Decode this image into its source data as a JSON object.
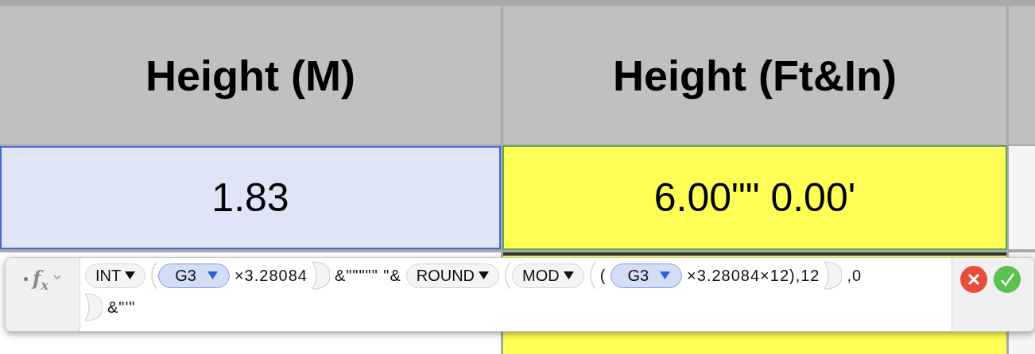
{
  "table": {
    "columns": [
      {
        "label": "Height (M)"
      },
      {
        "label": "Height (Ft&In)"
      }
    ],
    "rows": [
      {
        "cells": [
          {
            "value": "1.83",
            "selected": true,
            "editing": false,
            "color": "#dfe5f7"
          },
          {
            "value": "6.00\"\" 0.00'",
            "selected": false,
            "editing": true,
            "color": "#ffff55"
          }
        ]
      }
    ]
  },
  "formula_bar": {
    "label": "f$_{x}$",
    "lines": [
      [
        {
          "kind": "function",
          "label": "INT"
        },
        {
          "kind": "open"
        },
        {
          "kind": "ref",
          "label": "G3"
        },
        {
          "kind": "text",
          "label": "×3.28084"
        },
        {
          "kind": "close"
        },
        {
          "kind": "text",
          "label": "&\"\"\"\"\" \"&"
        },
        {
          "kind": "function",
          "label": "ROUND"
        },
        {
          "kind": "open"
        },
        {
          "kind": "function",
          "label": "MOD"
        },
        {
          "kind": "open"
        },
        {
          "kind": "text",
          "label": "("
        },
        {
          "kind": "ref",
          "label": "G3"
        },
        {
          "kind": "text",
          "label": "×3.28084×12),12"
        },
        {
          "kind": "close"
        },
        {
          "kind": "text",
          "label": ",0"
        }
      ],
      [
        {
          "kind": "close"
        },
        {
          "kind": "text",
          "label": "&\"'\""
        }
      ]
    ]
  }
}
